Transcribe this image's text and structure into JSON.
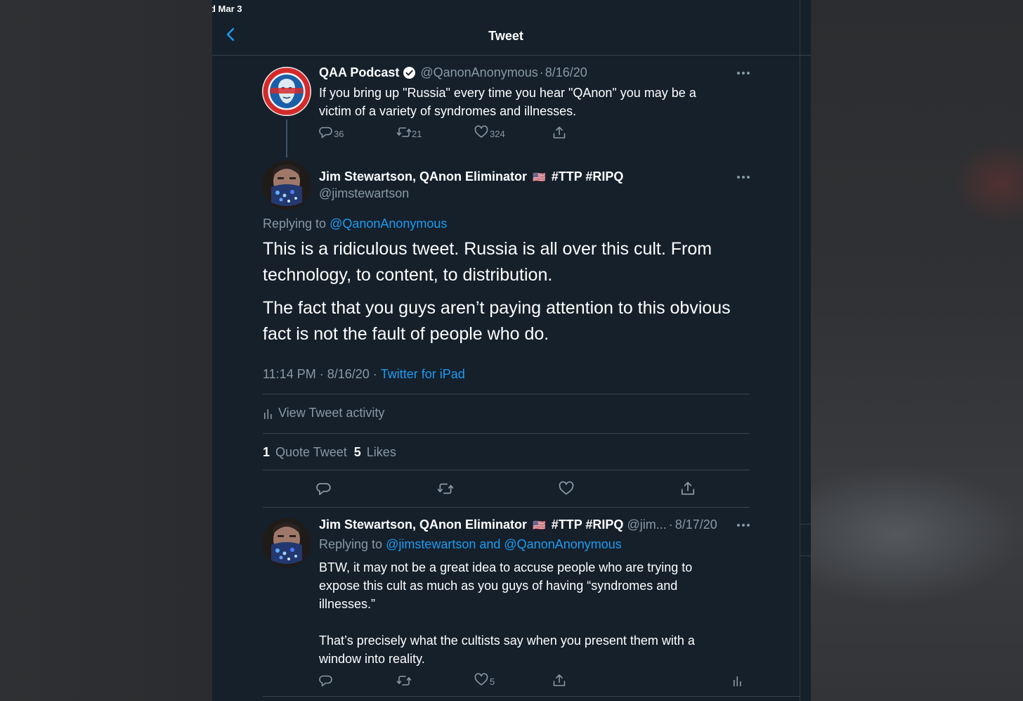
{
  "status_bar": {
    "date": "d Mar 3"
  },
  "header": {
    "title": "Tweet"
  },
  "parent_tweet": {
    "display_name": "QAA Podcast",
    "verified": true,
    "handle": "@QanonAnonymous",
    "separator": "·",
    "date": "8/16/20",
    "text_line1": "If you bring up \"Russia\" every time you hear \"QAnon\" you may be a",
    "text_line2": "victim of a variety of syndromes and illnesses.",
    "replies": "36",
    "retweets": "21",
    "likes": "324"
  },
  "main_tweet": {
    "display_name": "Jim Stewartson, QAnon Eliminator",
    "flag": "🇺🇸",
    "hashtags": "#TTP #RIPQ",
    "handle": "@jimstewartson",
    "replying_prefix": "Replying to",
    "replying_to": "@QanonAnonymous",
    "para1_line1": "This is a ridiculous tweet. Russia is all over this cult. From",
    "para1_line2": "technology, to content, to distribution.",
    "para2_line1": "The fact that you guys aren’t paying attention to this obvious",
    "para2_line2": "fact is not the fault of people who do.",
    "time": "11:14 PM",
    "dot": "·",
    "date": "8/16/20",
    "source": "Twitter for iPad",
    "activity_label": "View Tweet activity",
    "quote_count": "1",
    "quote_label": "Quote Tweet",
    "likes_count": "5",
    "likes_label": "Likes"
  },
  "reply_tweet": {
    "display_name": "Jim Stewartson, QAnon Eliminator",
    "flag": "🇺🇸",
    "hashtags": "#TTP #RIPQ",
    "handle": "@jim...",
    "separator": "·",
    "date": "8/17/20",
    "replying_prefix": "Replying to",
    "replying_to": "@jimstewartson and @QanonAnonymous",
    "text_line1": "BTW, it may not be a great idea to accuse people who are trying to",
    "text_line2": "expose this cult as much as you guys of having “syndromes and",
    "text_line3": "illnesses.”",
    "text_line4": "That’s precisely what the cultists say when you present them with a",
    "text_line5": "window into reality.",
    "likes": "5"
  },
  "colors": {
    "background": "#15202b",
    "accent": "#1d9bf0",
    "muted": "#8899a6",
    "divider": "#38444d"
  },
  "icons": [
    "back-chevron-icon",
    "verified-badge-icon",
    "more-icon",
    "reply-icon",
    "retweet-icon",
    "like-icon",
    "share-icon",
    "activity-icon",
    "flag-icon"
  ]
}
